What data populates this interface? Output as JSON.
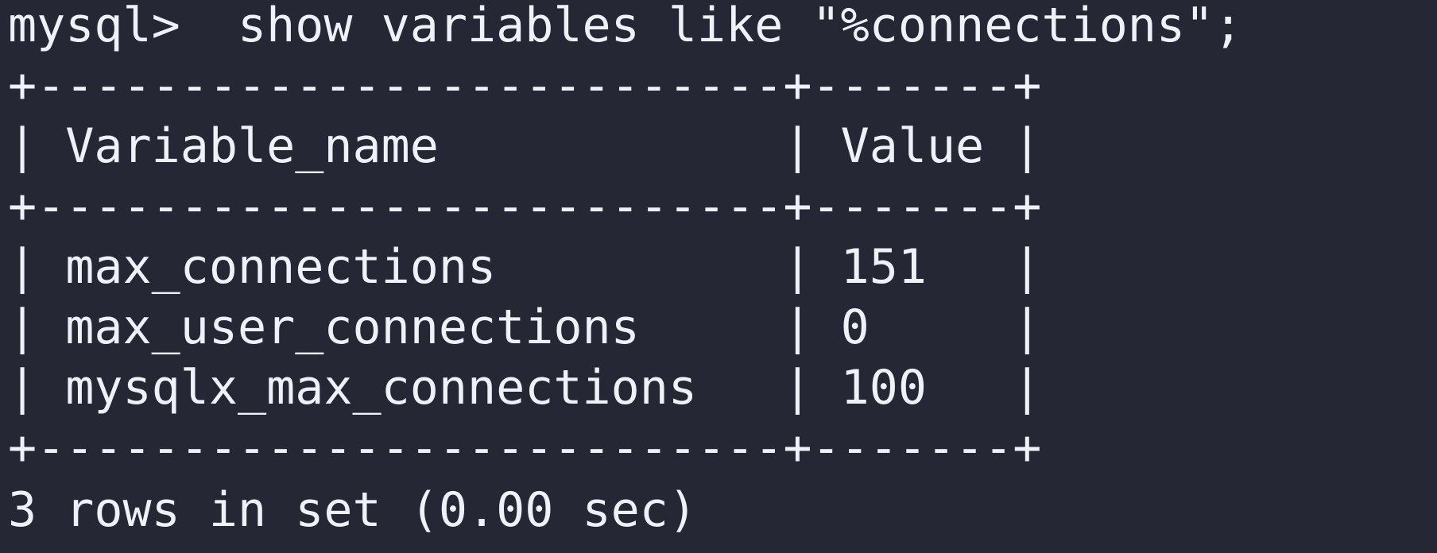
{
  "terminal": {
    "prompt": "mysql>",
    "command": "  show variables like \"%connections\";",
    "border_top": "+--------------------------+-------+",
    "header": "| Variable_name            | Value |",
    "border_mid": "+--------------------------+-------+",
    "rows": [
      "| max_connections          | 151   |",
      "| max_user_connections     | 0     |",
      "| mysqlx_max_connections   | 100   |"
    ],
    "border_bottom": "+--------------------------+-------+",
    "result_summary": "3 rows in set (0.00 sec)"
  },
  "result_table": {
    "columns": [
      "Variable_name",
      "Value"
    ],
    "rows": [
      [
        "max_connections",
        "151"
      ],
      [
        "max_user_connections",
        "0"
      ],
      [
        "mysqlx_max_connections",
        "100"
      ]
    ]
  },
  "colors": {
    "background": "#252834",
    "foreground": "#eef1f7"
  }
}
